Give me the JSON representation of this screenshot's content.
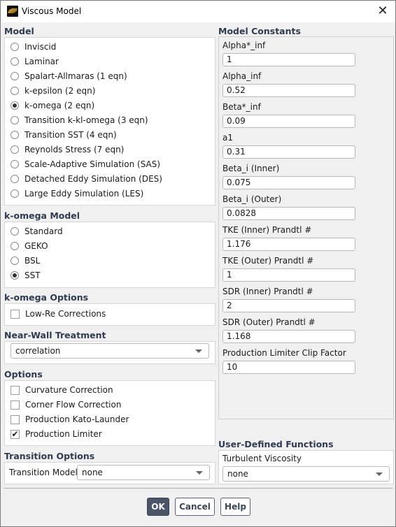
{
  "window": {
    "title": "Viscous Model",
    "close_icon": "close-icon",
    "app_icon": "fluent-app-icon"
  },
  "model": {
    "title": "Model",
    "options": [
      {
        "label": "Inviscid",
        "selected": false
      },
      {
        "label": "Laminar",
        "selected": false
      },
      {
        "label": "Spalart-Allmaras (1 eqn)",
        "selected": false
      },
      {
        "label": "k-epsilon (2 eqn)",
        "selected": false
      },
      {
        "label": "k-omega (2 eqn)",
        "selected": true
      },
      {
        "label": "Transition k-kl-omega (3 eqn)",
        "selected": false
      },
      {
        "label": "Transition SST (4 eqn)",
        "selected": false
      },
      {
        "label": "Reynolds Stress (7 eqn)",
        "selected": false
      },
      {
        "label": "Scale-Adaptive Simulation (SAS)",
        "selected": false
      },
      {
        "label": "Detached Eddy Simulation (DES)",
        "selected": false
      },
      {
        "label": "Large Eddy Simulation (LES)",
        "selected": false
      }
    ]
  },
  "komega_model": {
    "title": "k-omega Model",
    "options": [
      {
        "label": "Standard",
        "selected": false
      },
      {
        "label": "GEKO",
        "selected": false
      },
      {
        "label": "BSL",
        "selected": false
      },
      {
        "label": "SST",
        "selected": true
      }
    ]
  },
  "komega_options": {
    "title": "k-omega Options",
    "options": [
      {
        "label": "Low-Re Corrections",
        "checked": false
      }
    ]
  },
  "near_wall": {
    "title": "Near-Wall Treatment",
    "value": "correlation"
  },
  "options": {
    "title": "Options",
    "items": [
      {
        "label": "Curvature Correction",
        "checked": false
      },
      {
        "label": "Corner Flow Correction",
        "checked": false
      },
      {
        "label": "Production Kato-Launder",
        "checked": false
      },
      {
        "label": "Production Limiter",
        "checked": true
      }
    ]
  },
  "transition_options": {
    "title": "Transition Options",
    "label": "Transition Model",
    "value": "none"
  },
  "model_constants": {
    "title": "Model Constants",
    "items": [
      {
        "label": "Alpha*_inf",
        "value": "1"
      },
      {
        "label": "Alpha_inf",
        "value": "0.52"
      },
      {
        "label": "Beta*_inf",
        "value": "0.09"
      },
      {
        "label": "a1",
        "value": "0.31"
      },
      {
        "label": "Beta_i (Inner)",
        "value": "0.075"
      },
      {
        "label": "Beta_i (Outer)",
        "value": "0.0828"
      },
      {
        "label": "TKE (Inner) Prandtl #",
        "value": "1.176"
      },
      {
        "label": "TKE (Outer) Prandtl #",
        "value": "1"
      },
      {
        "label": "SDR (Inner) Prandtl #",
        "value": "2"
      },
      {
        "label": "SDR (Outer) Prandtl #",
        "value": "1.168"
      },
      {
        "label": "Production Limiter Clip Factor",
        "value": "10"
      }
    ]
  },
  "udf": {
    "title": "User-Defined Functions",
    "label": "Turbulent Viscosity",
    "value": "none"
  },
  "buttons": {
    "ok": "OK",
    "cancel": "Cancel",
    "help": "Help"
  },
  "check_glyph": "✔",
  "close_glyph": "✕"
}
